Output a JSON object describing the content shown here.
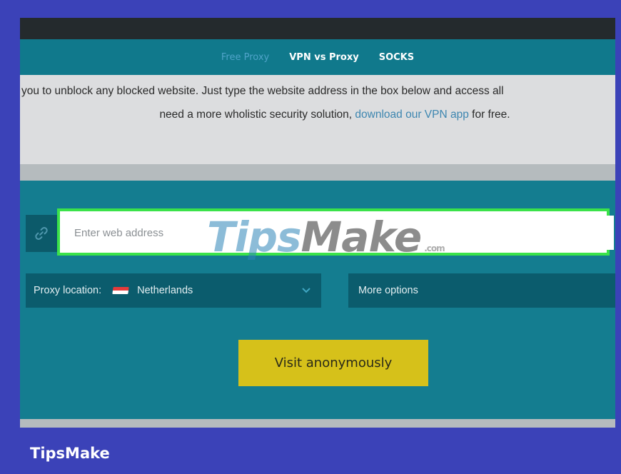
{
  "nav": {
    "items": [
      {
        "label": "Free Proxy",
        "active": true
      },
      {
        "label": "VPN vs Proxy",
        "active": false
      },
      {
        "label": "SOCKS",
        "active": false
      }
    ]
  },
  "intro": {
    "line1": "you to unblock any blocked website. Just type the website address in the box below and access all",
    "line2_before": "need a more wholistic security solution,",
    "line2_link": "download our VPN app",
    "line2_after": "for free."
  },
  "url_input": {
    "placeholder": "Enter web address",
    "value": ""
  },
  "watermark": {
    "part1": "Tips",
    "part2": "Make",
    "suffix": ".com"
  },
  "location": {
    "label": "Proxy location:",
    "value": "Netherlands",
    "flag": "netherlands-flag"
  },
  "more_options": {
    "label": "More options"
  },
  "submit": {
    "label": "Visit anonymously"
  },
  "brand": {
    "label": "TipsMake"
  },
  "colors": {
    "frame": "#3b42b8",
    "panel": "#147d90",
    "highlight": "#3be24a",
    "button": "#d6c11a",
    "link": "#3d86b0"
  }
}
